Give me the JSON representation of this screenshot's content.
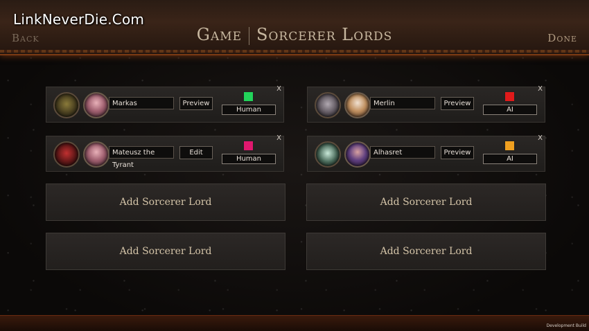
{
  "watermark": "LinkNeverDie.Com",
  "header": {
    "back_label": "Back",
    "done_label": "Done",
    "title_left": "Game",
    "title_right": "Sorcerer Lords"
  },
  "players": [
    {
      "name": "Markas",
      "action": "Preview",
      "type": "Human",
      "color": "#22d35a",
      "crest": "orc-crest-icon",
      "portrait": "sorceress-portrait"
    },
    {
      "name": "Merlin",
      "action": "Preview",
      "type": "AI",
      "color": "#e01a1a",
      "crest": "helm-crest-icon",
      "portrait": "wizard-portrait"
    },
    {
      "name": "Mateusz the Tyrant",
      "action": "Edit",
      "type": "Human",
      "color": "#e0186e",
      "crest": "blood-crest-icon",
      "portrait": "sorceress-portrait"
    },
    {
      "name": "Alhasret",
      "action": "Preview",
      "type": "AI",
      "color": "#f0a020",
      "crest": "skull-crest-icon",
      "portrait": "mage-portrait"
    }
  ],
  "close_label": "X",
  "add_slots": [
    "Add Sorcerer Lord",
    "Add Sorcerer Lord",
    "Add Sorcerer Lord",
    "Add Sorcerer Lord"
  ],
  "footer": {
    "dev_build": "Development Build"
  }
}
